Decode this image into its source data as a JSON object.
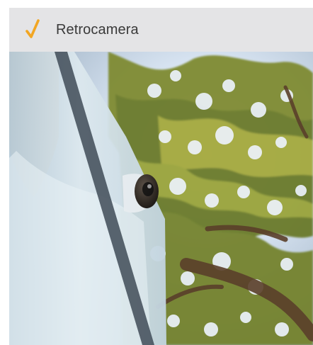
{
  "header": {
    "title": "Retrocamera",
    "check_icon": "checkmark-icon",
    "accent_color": "#f2a623"
  },
  "image": {
    "subject": "white-wall-camera-under-tree-canopy"
  }
}
